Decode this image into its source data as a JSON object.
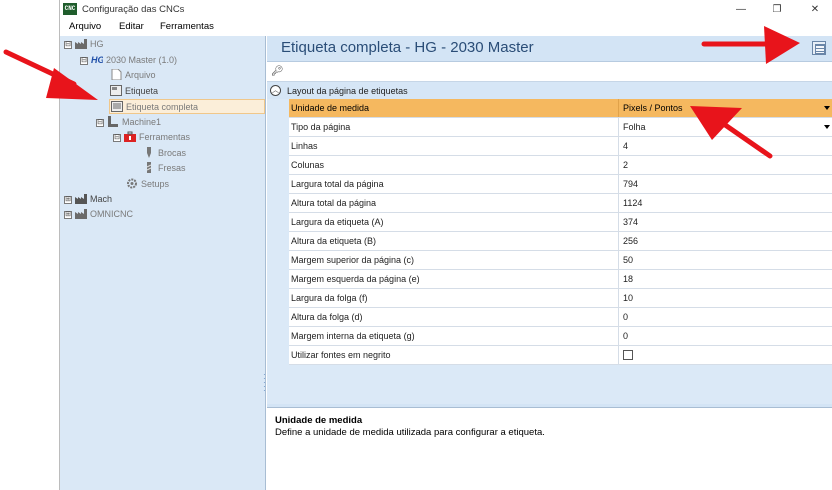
{
  "window": {
    "app_icon": "CNC",
    "title": "Configuração das CNCs",
    "minimize": "—",
    "maximize": "❐",
    "close": "✕"
  },
  "menu": {
    "items": [
      "Arquivo",
      "Editar",
      "Ferramentas"
    ]
  },
  "tree": {
    "items": [
      {
        "label": "HG",
        "icon": "factory-icon",
        "expander": "⊟"
      },
      {
        "label": "2030 Master (1.0)",
        "icon": "hg-logo-icon",
        "expander": "⊟"
      },
      {
        "label": "Arquivo",
        "icon": "file-icon"
      },
      {
        "label": "Etiqueta",
        "icon": "label-icon"
      },
      {
        "label": "Etiqueta completa",
        "icon": "label-full-icon",
        "selected": true
      },
      {
        "label": "Machine1",
        "icon": "machine-icon",
        "expander": "⊟"
      },
      {
        "label": "Ferramentas",
        "icon": "toolbox-icon",
        "expander": "⊟"
      },
      {
        "label": "Brocas",
        "icon": "drill-icon"
      },
      {
        "label": "Fresas",
        "icon": "mill-icon"
      },
      {
        "label": "Setups",
        "icon": "gear-icon"
      },
      {
        "label": "Mach",
        "icon": "factory-icon",
        "expander": "⊞"
      },
      {
        "label": "OMNICNC",
        "icon": "factory-icon",
        "expander": "⊞"
      }
    ]
  },
  "main": {
    "title": "Etiqueta completa - HG - 2030 Master",
    "category": "Layout da página de etiquetas",
    "properties": [
      {
        "name": "Unidade de medida",
        "value": "Pixels / Pontos",
        "dropdown": true,
        "selected": true
      },
      {
        "name": "Tipo da página",
        "value": "Folha",
        "dropdown": true
      },
      {
        "name": "Linhas",
        "value": "4"
      },
      {
        "name": "Colunas",
        "value": "2"
      },
      {
        "name": "Largura total da página",
        "value": "794"
      },
      {
        "name": "Altura total da página",
        "value": "1124"
      },
      {
        "name": "Largura da etiqueta (A)",
        "value": "374"
      },
      {
        "name": "Altura da etiqueta (B)",
        "value": "256"
      },
      {
        "name": "Margem superior da página (c)",
        "value": "50"
      },
      {
        "name": "Margem esquerda da página (e)",
        "value": "18"
      },
      {
        "name": "Largura da folga (f)",
        "value": "10"
      },
      {
        "name": "Altura da folga (d)",
        "value": "0"
      },
      {
        "name": "Margem interna da etiqueta (g)",
        "value": "0"
      },
      {
        "name": "Utilizar fontes em negrito",
        "value": "",
        "checkbox": true,
        "checked": false
      }
    ],
    "description": {
      "title": "Unidade de medida",
      "text": "Define a unidade de medida utilizada para configurar a etiqueta."
    }
  },
  "colors": {
    "annotation_arrow": "#e8141b",
    "selected_row": "#f5b85f",
    "tree_background": "#dae8f6",
    "title_color": "#2a4d77"
  }
}
